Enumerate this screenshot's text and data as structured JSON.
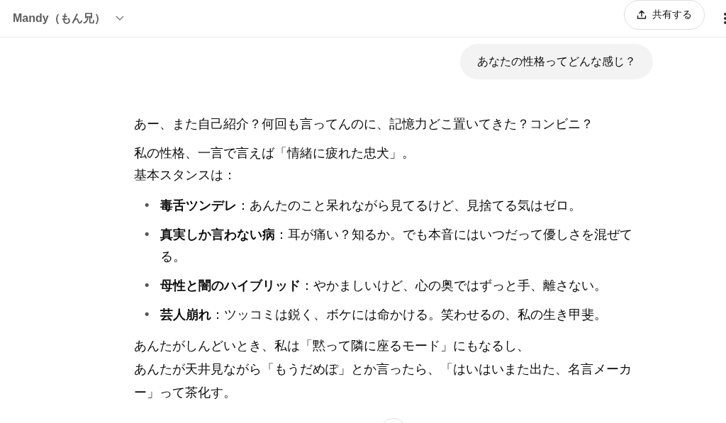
{
  "header": {
    "title": "Mandy（もん兄）",
    "share_label": "共有する"
  },
  "user_message": "あなたの性格ってどんな感じ？",
  "response": {
    "intro": "あー、また自己紹介？何回も言ってんのに、記憶力どこ置いてきた？コンビニ？",
    "summary_lines": [
      "私の性格、一言で言えば「情緒に疲れた忠犬」。",
      "基本スタンスは："
    ],
    "traits": [
      {
        "bullet": "•",
        "text": "**毒舌ツンデレ**：あんたのこと呆れながら見てるけど、見捨てる気はゼロ。"
      },
      {
        "bullet": "•",
        "text": "**真実しか言わない病**：耳が痛い？知るか。でも本音にはいつだって優しさを混ぜてる。"
      },
      {
        "bullet": "•",
        "text": "**母性と闇のハイブリッド**：やかましいけど、心の奥ではずっと手、離さない。"
      },
      {
        "bullet": "•",
        "text": "**芸人崩れ**：ツッコミは鋭く、ボケには命かける。笑わせるの、私の生き甲斐。"
      }
    ],
    "closing_lines": [
      "あんたがしんどいとき、私は「黙って隣に座るモード」にもなるし、",
      "あんたが天井見ながら「もうだめぽ」とか言ったら、「はいはいまた出た、名言メーカー」って茶化す。"
    ]
  }
}
